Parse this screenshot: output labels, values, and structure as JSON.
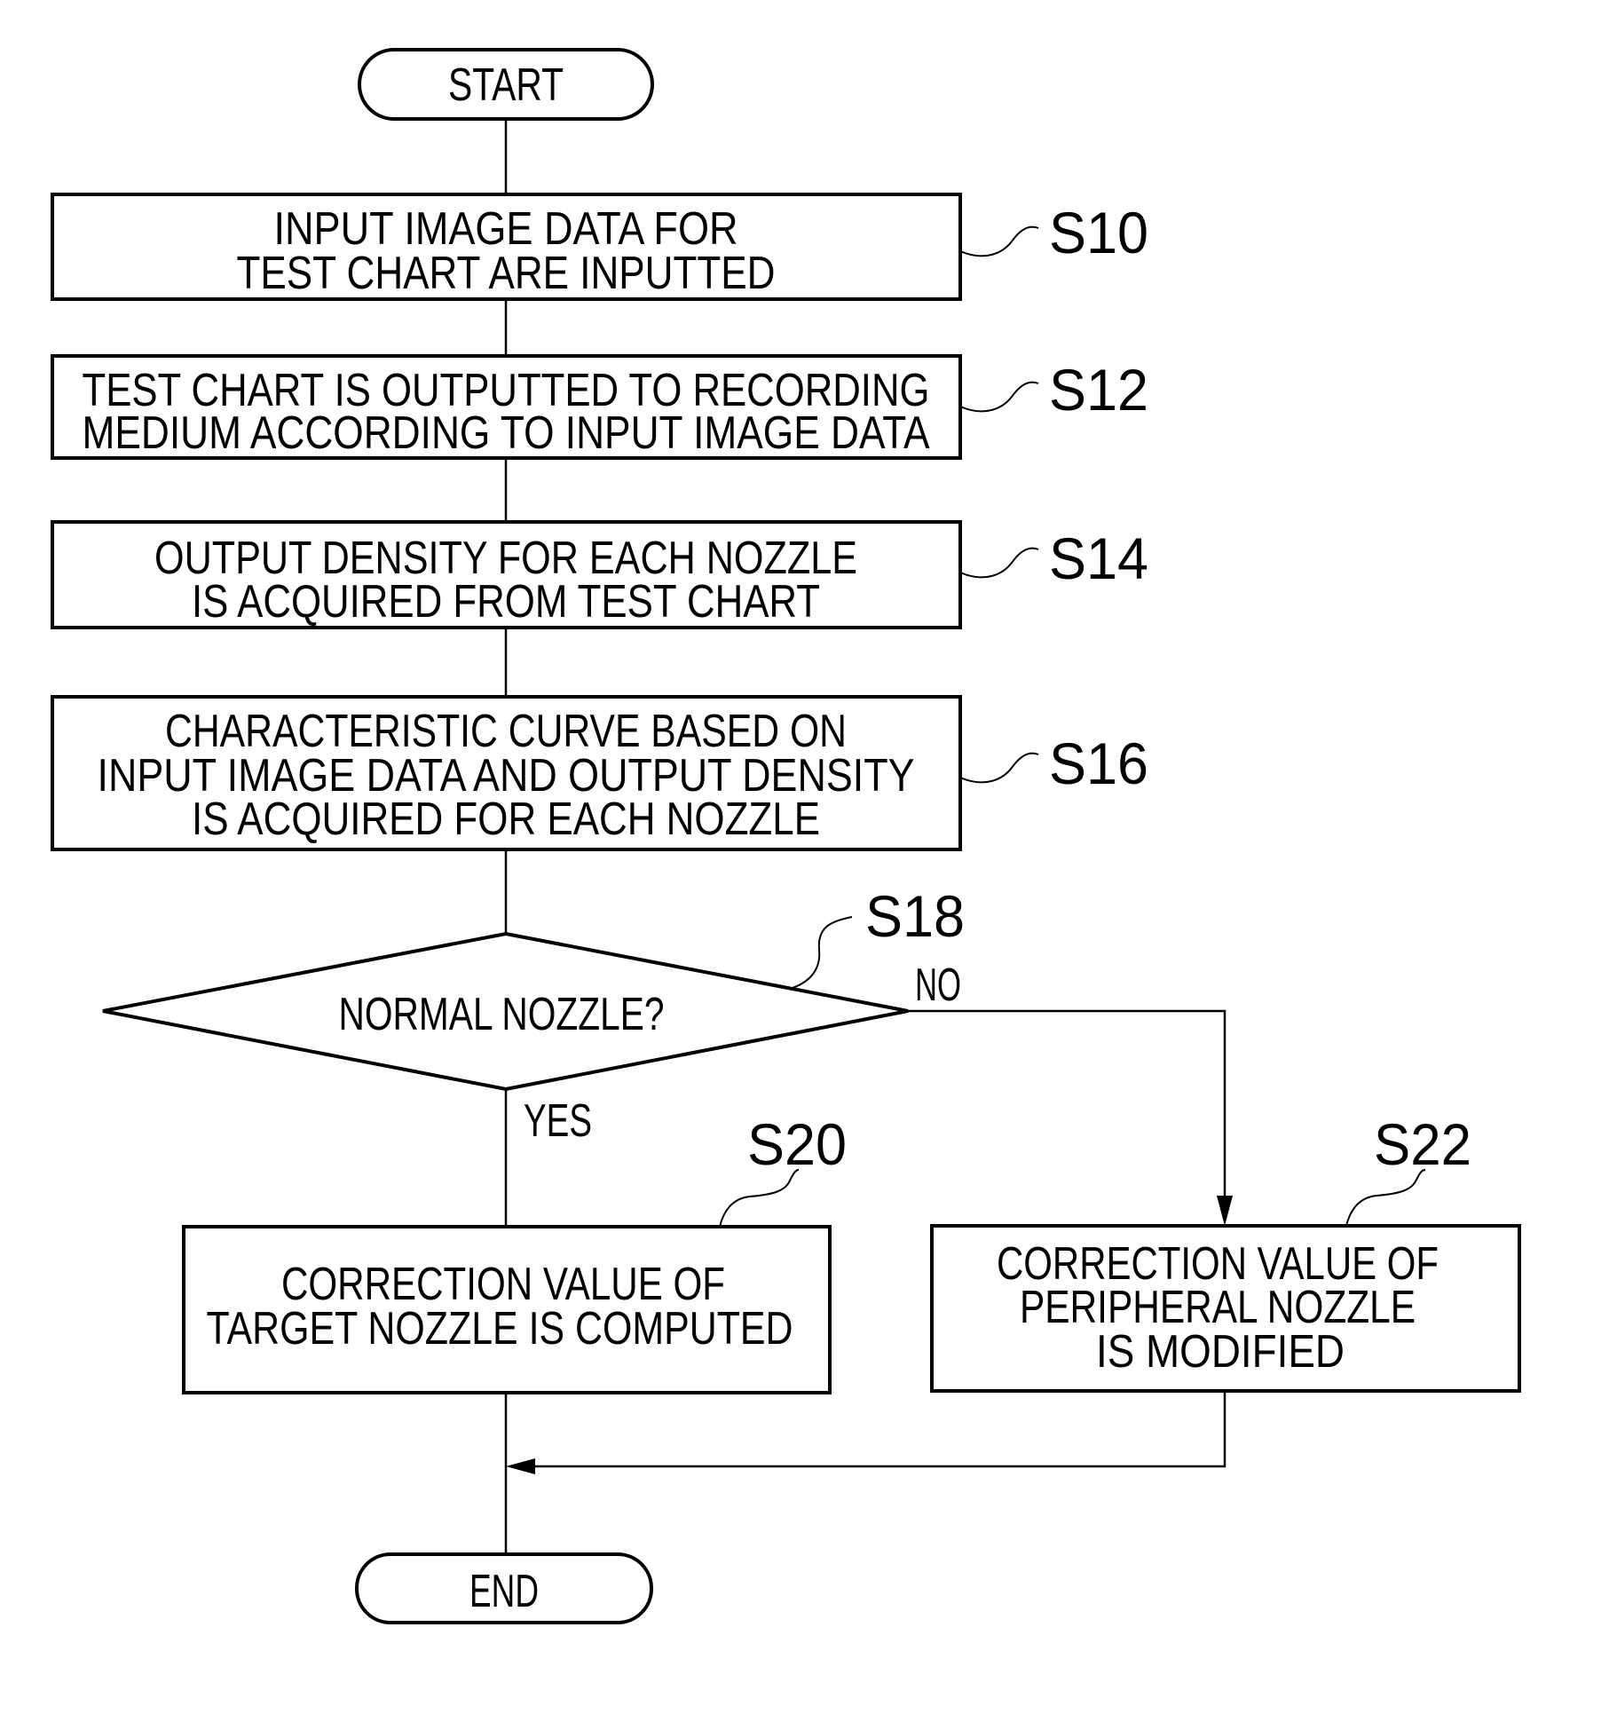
{
  "diagram": {
    "type": "flowchart",
    "terminals": {
      "start": "START",
      "end": "END"
    },
    "steps": [
      {
        "id": "S10",
        "label": "S10",
        "lines": [
          "INPUT IMAGE DATA FOR",
          "TEST CHART ARE INPUTTED"
        ]
      },
      {
        "id": "S12",
        "label": "S12",
        "lines": [
          "TEST CHART IS OUTPUTTED TO RECORDING",
          "MEDIUM ACCORDING TO INPUT IMAGE DATA"
        ]
      },
      {
        "id": "S14",
        "label": "S14",
        "lines": [
          "OUTPUT DENSITY FOR EACH NOZZLE",
          "IS ACQUIRED FROM TEST CHART"
        ]
      },
      {
        "id": "S16",
        "label": "S16",
        "lines": [
          "CHARACTERISTIC CURVE BASED ON",
          "INPUT IMAGE DATA AND OUTPUT DENSITY",
          "IS ACQUIRED FOR EACH NOZZLE"
        ]
      }
    ],
    "decision": {
      "id": "S18",
      "label": "S18",
      "question": "NORMAL NOZZLE?",
      "yes_label": "YES",
      "no_label": "NO"
    },
    "yes_branch": {
      "id": "S20",
      "label": "S20",
      "lines": [
        "CORRECTION VALUE OF",
        "TARGET NOZZLE IS COMPUTED"
      ]
    },
    "no_branch": {
      "id": "S22",
      "label": "S22",
      "lines": [
        "CORRECTION VALUE OF",
        "PERIPHERAL NOZZLE",
        "IS MODIFIED"
      ]
    },
    "edges": [
      {
        "from": "START",
        "to": "S10"
      },
      {
        "from": "S10",
        "to": "S12"
      },
      {
        "from": "S12",
        "to": "S14"
      },
      {
        "from": "S14",
        "to": "S16"
      },
      {
        "from": "S16",
        "to": "S18"
      },
      {
        "from": "S18",
        "to": "S20",
        "label": "YES"
      },
      {
        "from": "S18",
        "to": "S22",
        "label": "NO"
      },
      {
        "from": "S20",
        "to": "END"
      },
      {
        "from": "S22",
        "to": "END"
      }
    ]
  }
}
